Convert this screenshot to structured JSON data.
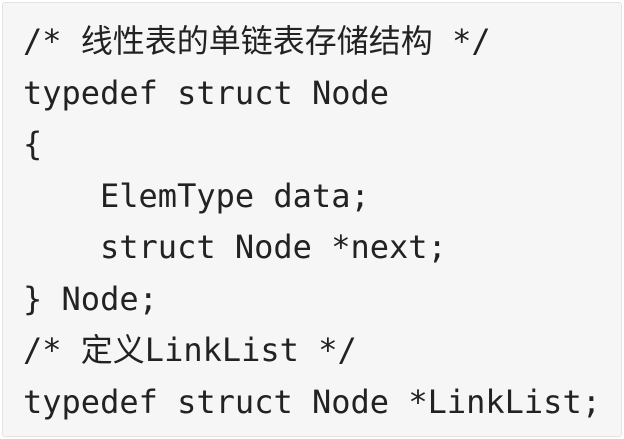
{
  "code": {
    "lines": [
      "/* 线性表的单链表存储结构 */",
      "typedef struct Node",
      "{",
      "ElemType data;",
      "struct Node *next;",
      "} Node;",
      "/* 定义LinkList */",
      "typedef struct Node *LinkList;"
    ]
  }
}
